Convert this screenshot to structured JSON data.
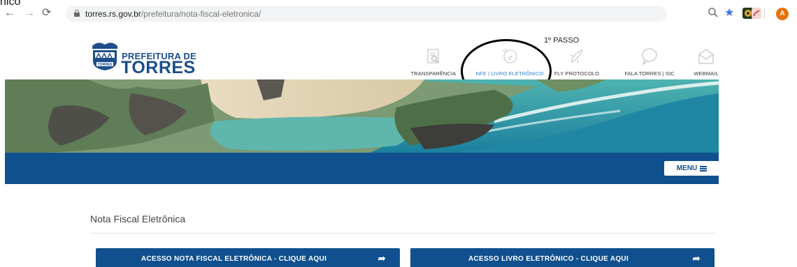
{
  "overlay": {
    "clip_text": "nico"
  },
  "browser": {
    "url_host": "torres.rs.gov.br",
    "url_path": "/prefeitura/nota-fiscal-eletronica/",
    "avatar_letter": "A",
    "icons": [
      "back-arrow-icon",
      "forward-arrow-icon",
      "reload-icon",
      "lock-icon",
      "zoom-icon",
      "star-icon",
      "extension-icon",
      "pdf-icon",
      "profile-avatar"
    ]
  },
  "site": {
    "logo_top": "PREFEITURA DE",
    "logo_bottom": "TORRES",
    "emblem_text": "TORRES",
    "step_annotation": "1º PASSO",
    "quick_links": [
      {
        "label": "TRANSPARÊNCIA",
        "icon": "magnifier-document-icon"
      },
      {
        "label": "NFE | LIVRO ELETRÔNICO",
        "icon": "e-document-icon",
        "active": true
      },
      {
        "label": "FLY PROTOCOLO",
        "icon": "plane-icon"
      },
      {
        "label": "FALA TORRES | SIC",
        "icon": "speech-bubble-icon"
      },
      {
        "label": "WEBMAIL",
        "icon": "envelope-icon"
      }
    ],
    "menu_label": "MENU",
    "page_title": "Nota Fiscal Eletrônica",
    "buttons": [
      {
        "label": "ACESSO NOTA FISCAL ELETRÔNICA - CLIQUE AQUI"
      },
      {
        "label": "ACESSO LIVRO ELETRÔNICO - CLIQUE AQUI"
      }
    ]
  },
  "colors": {
    "brand_blue": "#10508e",
    "active_link": "#2b7fd4",
    "annotation_circle": "#000000"
  }
}
